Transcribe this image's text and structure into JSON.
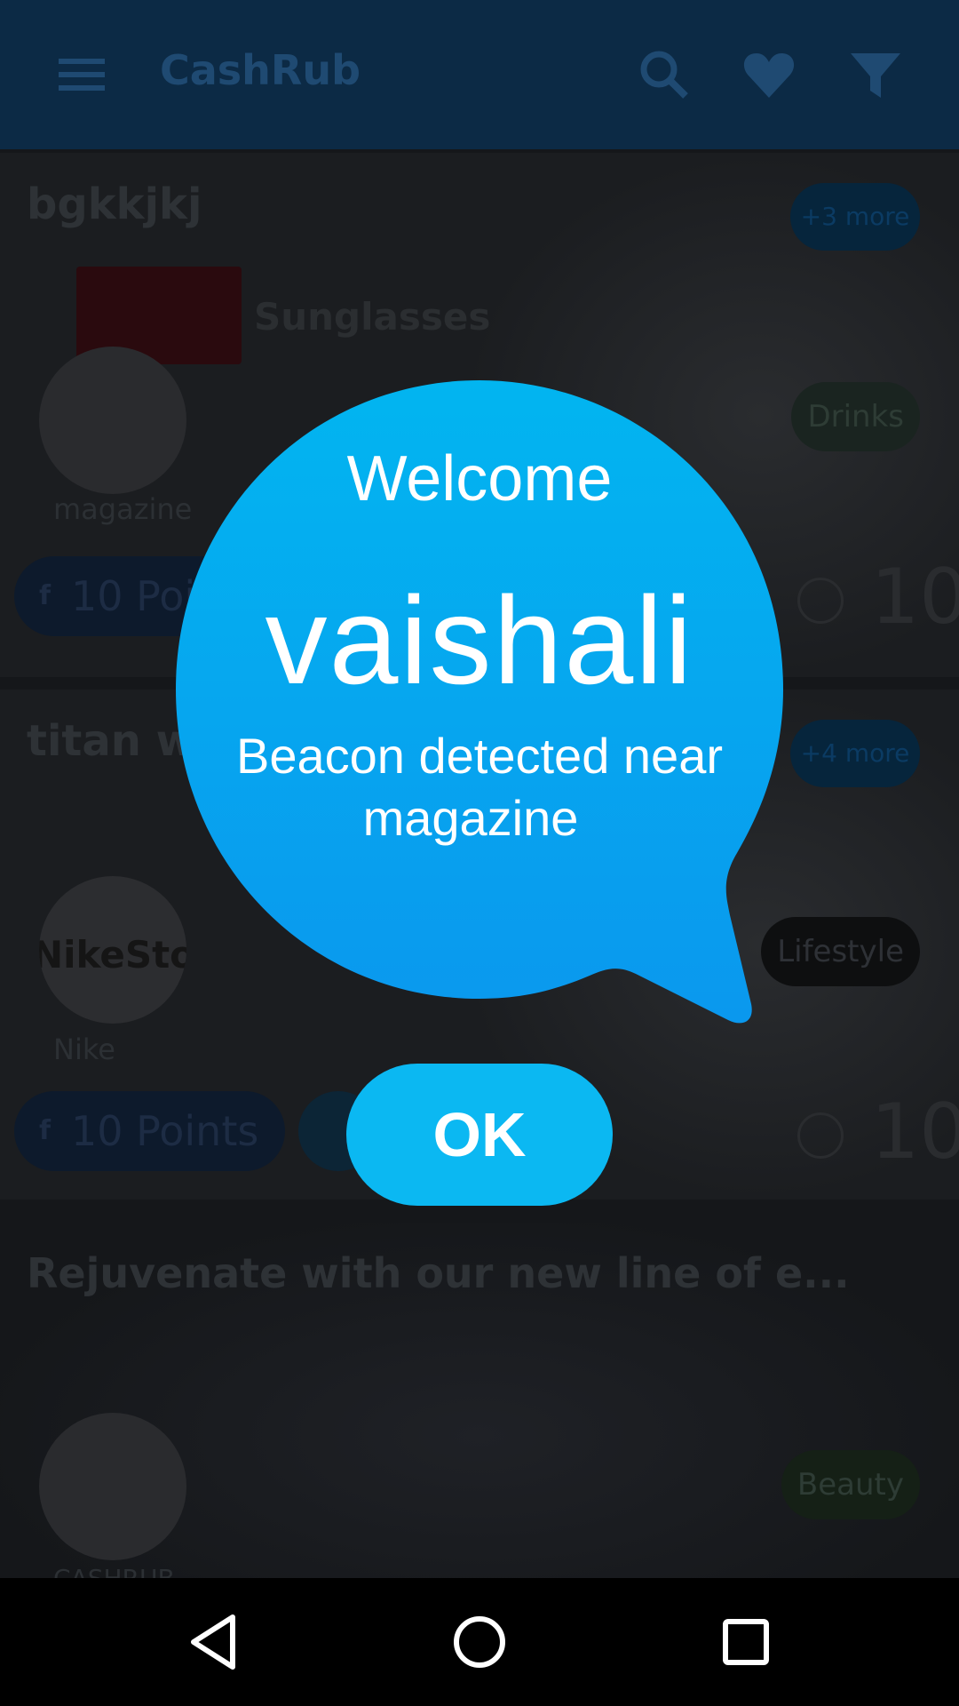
{
  "app": {
    "title": "CashRub",
    "toolbar_icons": [
      "menu-icon",
      "search-icon",
      "heart-icon",
      "filter-icon"
    ]
  },
  "cards": [
    {
      "title": "bgkkjkj",
      "more": "+3 more",
      "brand_banner": "Sunglasses",
      "merchant": "magazine",
      "category": "Drinks",
      "points": "10 Points",
      "reward": "10"
    },
    {
      "title": "titan watch",
      "more": "+4 more",
      "merchant": "Nike",
      "avatar_text": "NikeStore",
      "category": "Lifestyle",
      "points": "10 Points",
      "reward": "10"
    },
    {
      "title": "Rejuvenate with our new line of e...",
      "merchant": "CASHRUB",
      "category": "Beauty"
    }
  ],
  "dialog": {
    "greeting": "Welcome",
    "user_name": "vaishali",
    "message_line1": "Beacon detected near",
    "message_line2": "magazine",
    "ok_label": "OK",
    "bubble_color_top": "#02b5f0",
    "bubble_color_bottom": "#0a98ee"
  },
  "navbar": {
    "icons": [
      "back-icon",
      "home-icon",
      "recents-icon"
    ]
  }
}
